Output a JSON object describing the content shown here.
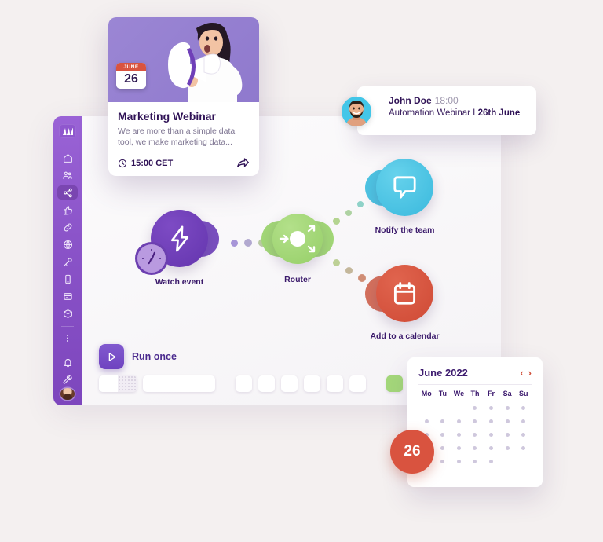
{
  "colors": {
    "background": "#f4f0f0",
    "sidebar": "#8f57ce",
    "purple_node": "#6f3fb8",
    "green_node": "#a4d87a",
    "blue_node": "#4cc4e0",
    "red_node": "#d9533f",
    "accent_text": "#3b1a6b"
  },
  "sidebar": {
    "logo_name": "make-logo-icon",
    "items": [
      {
        "icon": "home-icon",
        "label": "Home",
        "active": false
      },
      {
        "icon": "team-icon",
        "label": "Team",
        "active": false
      },
      {
        "icon": "share-icon",
        "label": "Scenarios",
        "active": true
      },
      {
        "icon": "thumbs-up-icon",
        "label": "Templates",
        "active": false
      },
      {
        "icon": "link-icon",
        "label": "Connections",
        "active": false
      },
      {
        "icon": "globe-icon",
        "label": "Webhooks",
        "active": false
      },
      {
        "icon": "key-icon",
        "label": "Keys",
        "active": false
      },
      {
        "icon": "mobile-icon",
        "label": "Devices",
        "active": false
      },
      {
        "icon": "database-icon",
        "label": "Data stores",
        "active": false
      },
      {
        "icon": "cube-icon",
        "label": "Data structures",
        "active": false
      },
      {
        "icon": "more-icon",
        "label": "More",
        "active": false
      },
      {
        "icon": "bell-icon",
        "label": "Notifications",
        "active": false
      },
      {
        "icon": "wrench-icon",
        "label": "Settings",
        "active": false
      }
    ],
    "avatar_name": "user-avatar"
  },
  "flow": {
    "nodes": [
      {
        "id": "watch-event",
        "label": "Watch event",
        "icon": "lightning-bolt-icon",
        "color": "#6f3fb8"
      },
      {
        "id": "router",
        "label": "Router",
        "icon": "router-arrows-icon",
        "color": "#a4d87a"
      },
      {
        "id": "notify-the-team",
        "label": "Notify the team",
        "icon": "chat-bubble-icon",
        "color": "#4cc4e0"
      },
      {
        "id": "add-to-calendar",
        "label": "Add to a calendar",
        "icon": "calendar-icon",
        "color": "#d9533f"
      }
    ]
  },
  "toolbar": {
    "run_once_label": "Run once",
    "run_icon": "play-icon",
    "swatches": [
      "#a4d87a",
      "#a97fe0",
      "#d9604a",
      "#ffffff"
    ]
  },
  "webinar_card": {
    "badge_month": "JUNE",
    "badge_day": "26",
    "title": "Marketing Webinar",
    "description": "We are more than a simple data tool, we make marketing data...",
    "time": "15:00 CET",
    "clock_icon": "clock-icon",
    "share_icon": "share-arrow-icon"
  },
  "notification": {
    "avatar_name": "john-doe-avatar",
    "name": "John Doe",
    "time": "18:00",
    "message_prefix": "Automation Webinar I ",
    "message_bold": "26th June"
  },
  "calendar": {
    "title": "June 2022",
    "prev_icon": "chevron-left-icon",
    "next_icon": "chevron-right-icon",
    "weekdays": [
      "Mo",
      "Tu",
      "We",
      "Th",
      "Fr",
      "Sa",
      "Su"
    ],
    "today": "26",
    "grid": [
      [
        0,
        0,
        0,
        1,
        1,
        1,
        1
      ],
      [
        1,
        1,
        1,
        1,
        1,
        1,
        1
      ],
      [
        1,
        1,
        1,
        1,
        1,
        1,
        1
      ],
      [
        1,
        1,
        1,
        1,
        1,
        1,
        1
      ],
      [
        1,
        1,
        1,
        1,
        1,
        0,
        0
      ]
    ]
  }
}
